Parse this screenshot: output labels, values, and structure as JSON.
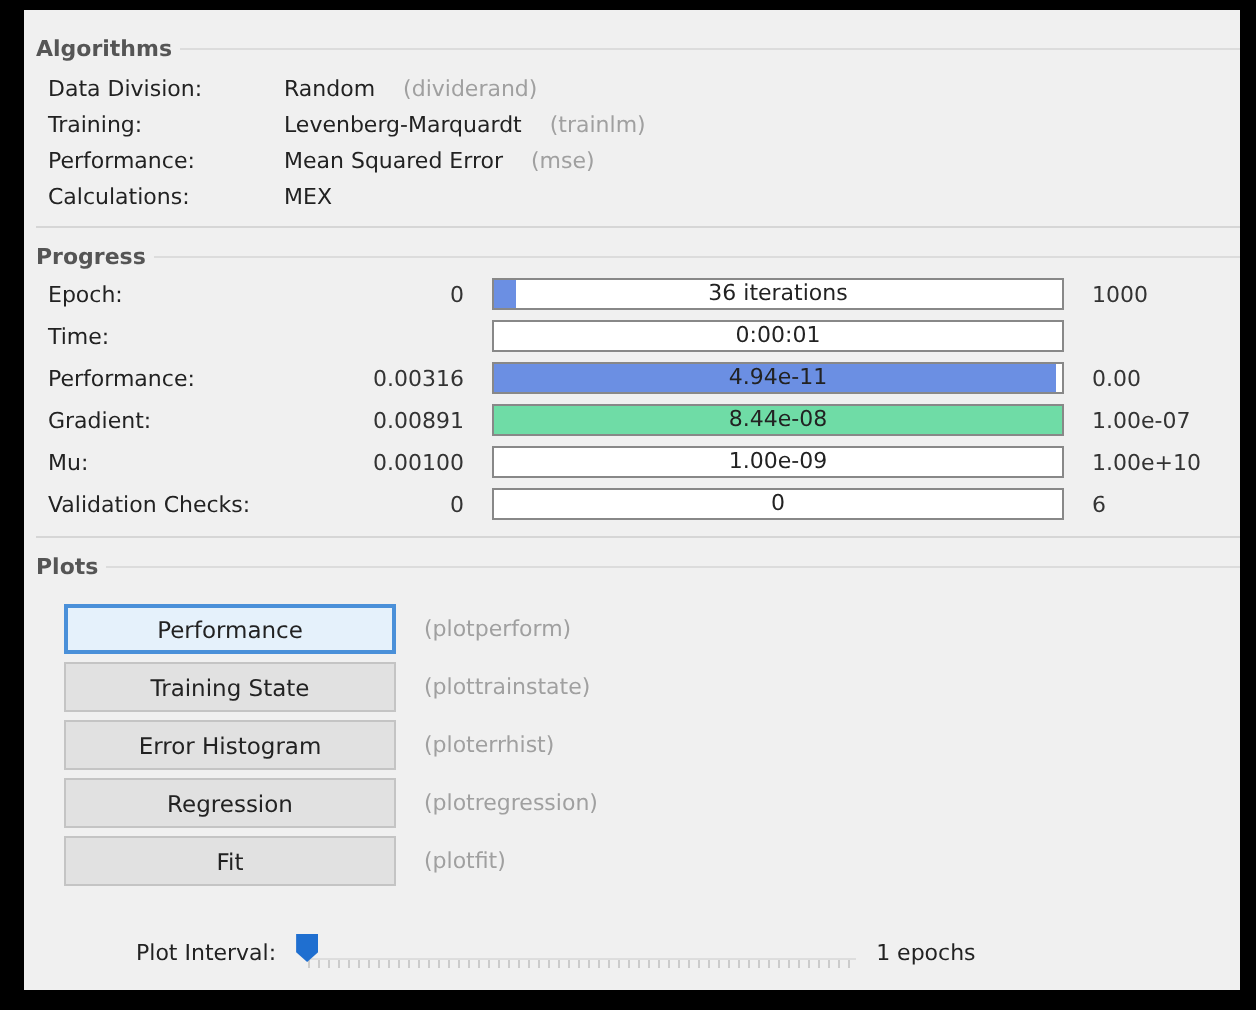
{
  "algorithms": {
    "title": "Algorithms",
    "rows": [
      {
        "label": "Data Division:",
        "value": "Random",
        "function": "(dividerand)"
      },
      {
        "label": "Training:",
        "value": "Levenberg-Marquardt",
        "function": "(trainlm)"
      },
      {
        "label": "Performance:",
        "value": "Mean Squared Error",
        "function": "(mse)"
      },
      {
        "label": "Calculations:",
        "value": "MEX"
      }
    ]
  },
  "progress": {
    "title": "Progress",
    "rows": [
      {
        "label": "Epoch:",
        "start": "0",
        "bar_text": "36 iterations",
        "level": 0.04,
        "color": "#6b8fe3",
        "end": "1000"
      },
      {
        "label": "Time:",
        "bar_text": "0:00:01",
        "level": 0
      },
      {
        "label": "Performance:",
        "start": "0.00316",
        "bar_text": "4.94e-11",
        "level": 0.99,
        "color": "#6b8fe3",
        "end": "0.00"
      },
      {
        "label": "Gradient:",
        "start": "0.00891",
        "bar_text": "8.44e-08",
        "level": 1,
        "color": "#6fdca6",
        "end": "1.00e-07"
      },
      {
        "label": "Mu:",
        "start": "0.00100",
        "bar_text": "1.00e-09",
        "level": 0,
        "end": "1.00e+10"
      },
      {
        "label": "Validation Checks:",
        "start": "0",
        "bar_text": "0",
        "level": 0,
        "end": "6"
      }
    ]
  },
  "plots": {
    "title": "Plots",
    "buttons": [
      {
        "label": "Performance",
        "function": "(plotperform)",
        "selected": true
      },
      {
        "label": "Training State",
        "function": "(plottrainstate)",
        "selected": false
      },
      {
        "label": "Error Histogram",
        "function": "(ploterrhist)",
        "selected": false
      },
      {
        "label": "Regression",
        "function": "(plotregression)",
        "selected": false
      },
      {
        "label": "Fit",
        "function": "(plotfit)",
        "selected": false
      }
    ],
    "interval": {
      "label": "Plot Interval:",
      "level": 0,
      "reading": "1 epochs"
    }
  }
}
